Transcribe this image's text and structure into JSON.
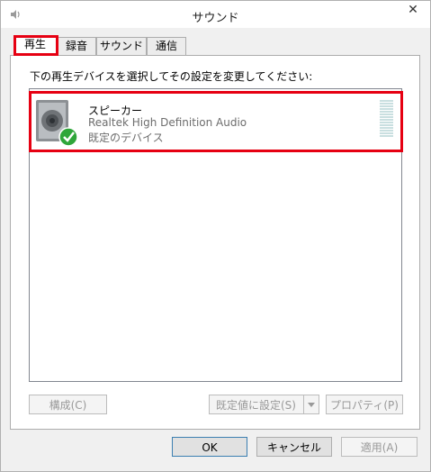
{
  "window": {
    "title": "サウンド",
    "close_glyph": "✕"
  },
  "tabs": [
    {
      "label": "再生",
      "active": true
    },
    {
      "label": "録音",
      "active": false
    },
    {
      "label": "サウンド",
      "active": false
    },
    {
      "label": "通信",
      "active": false
    }
  ],
  "instruction": "下の再生デバイスを選択してその設定を変更してください:",
  "device": {
    "name": "スピーカー",
    "description": "Realtek High Definition Audio",
    "status": "既定のデバイス",
    "icon": "speaker-icon",
    "badge": "check-icon"
  },
  "buttons": {
    "configure": "構成(C)",
    "set_default": "既定値に設定(S)",
    "properties": "プロパティ(P)",
    "ok": "OK",
    "cancel": "キャンセル",
    "apply": "適用(A)"
  },
  "colors": {
    "highlight": "#e60012",
    "check": "#2fa63a"
  }
}
